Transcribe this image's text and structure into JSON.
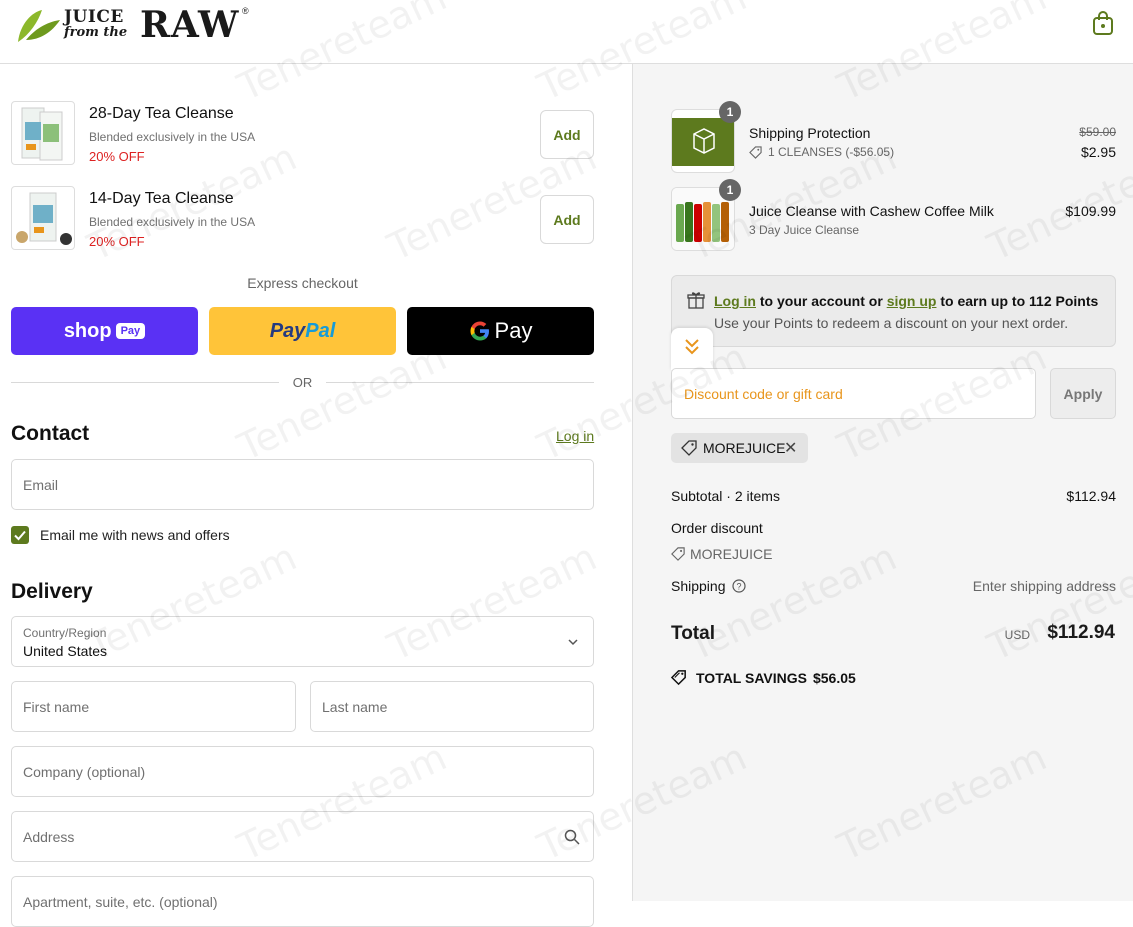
{
  "brand": {
    "juice": "JUICE",
    "from_the": "from the",
    "raw": "RAW",
    "reg": "®"
  },
  "upsells": [
    {
      "name": "28-Day Tea Cleanse",
      "sub": "Blended exclusively in the USA",
      "discount": "20% OFF",
      "button": "Add"
    },
    {
      "name": "14-Day Tea Cleanse",
      "sub": "Blended exclusively in the USA",
      "discount": "20% OFF",
      "button": "Add"
    }
  ],
  "express": {
    "label": "Express checkout",
    "shoppay_text": "shop",
    "shoppay_badge": "Pay",
    "paypal_a": "Pay",
    "paypal_b": "Pal",
    "gpay_g": "G",
    "gpay_text": "Pay",
    "or": "OR"
  },
  "contact": {
    "title": "Contact",
    "login": "Log in",
    "email_placeholder": "Email",
    "newsletter_label": "Email me with news and offers",
    "newsletter_checked": true
  },
  "delivery": {
    "title": "Delivery",
    "country_label": "Country/Region",
    "country_value": "United States",
    "first_name": "First name",
    "last_name": "Last name",
    "company": "Company (optional)",
    "address": "Address",
    "apartment": "Apartment, suite, etc. (optional)"
  },
  "summary": {
    "items": [
      {
        "name": "Shipping Protection",
        "sub": "1 CLEANSES (-$56.05)",
        "qty": "1",
        "old_price": "$59.00",
        "price": "$2.95"
      },
      {
        "name": "Juice Cleanse with Cashew Coffee Milk",
        "sub": "3 Day Juice Cleanse",
        "qty": "1",
        "price": "$109.99"
      }
    ],
    "points": {
      "login": "Log in",
      "to_your_account_or": " to your account or ",
      "signup": "sign up",
      "earn": " to earn up to 112 Points",
      "line2": "Use your Points to redeem a discount on your next order."
    },
    "discount_placeholder": "Discount code or gift card",
    "apply": "Apply",
    "applied_code": "MOREJUICE",
    "subtotal_label": "Subtotal · 2 items",
    "subtotal_value": "$112.94",
    "order_discount_label": "Order discount",
    "order_discount_code": "MOREJUICE",
    "shipping_label": "Shipping",
    "shipping_value": "Enter shipping address",
    "total_label": "Total",
    "currency": "USD",
    "total_value": "$112.94",
    "savings_label": "TOTAL SAVINGS",
    "savings_value": "$56.05"
  },
  "watermark": "Tenereteam",
  "colors": {
    "accent": "#5d7a1e",
    "shoppay": "#5a31f4",
    "paypal": "#ffc439",
    "discount_red": "#dd2222",
    "placeholder_orange": "#e8951c"
  }
}
